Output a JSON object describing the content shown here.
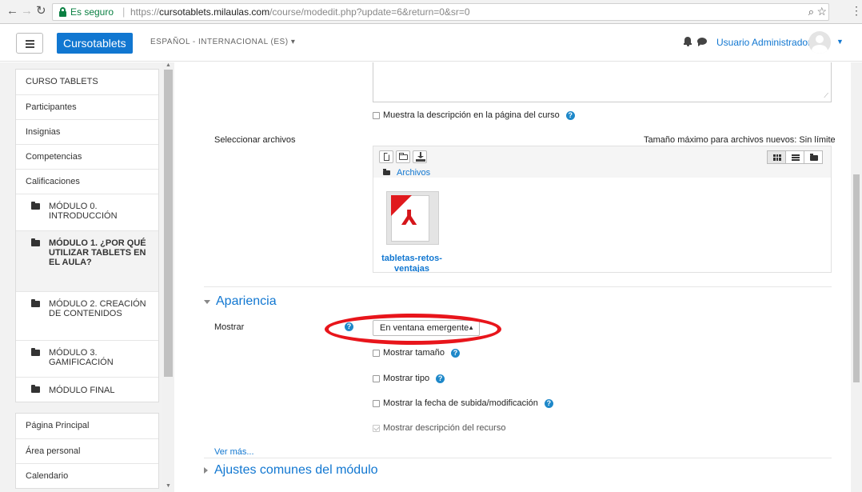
{
  "browser": {
    "secure_label": "Es seguro",
    "url_scheme": "https://",
    "url_host": "cursotablets.milaulas.com",
    "url_path": "/course/modedit.php?update=6&return=0&sr=0"
  },
  "navbar": {
    "brand": "Cursotablets",
    "language": "ESPAÑOL - INTERNACIONAL (ES) ▾",
    "user_name": "Usuario Administrador"
  },
  "sidebar": {
    "nav1": [
      {
        "label": "CURSO TABLETS"
      },
      {
        "label": "Participantes"
      },
      {
        "label": "Insignias"
      },
      {
        "label": "Competencias"
      },
      {
        "label": "Calificaciones"
      },
      {
        "label": "MÓDULO 0. INTRODUCCIÓN"
      },
      {
        "label": "MÓDULO 1. ¿POR QUÉ UTILIZAR TABLETS EN EL AULA?"
      },
      {
        "label": "MÓDULO 2. CREACIÓN DE CONTENIDOS"
      },
      {
        "label": "MÓDULO 3. GAMIFICACIÓN"
      },
      {
        "label": "MÓDULO FINAL"
      }
    ],
    "nav2": [
      {
        "label": "Página Principal"
      },
      {
        "label": "Área personal"
      },
      {
        "label": "Calendario"
      }
    ]
  },
  "form": {
    "show_description": "Muestra la descripción en la página del curso",
    "select_files_label": "Seleccionar archivos",
    "max_size": "Tamaño máximo para archivos nuevos: Sin límite",
    "breadcrumb": "Archivos",
    "file_name": "tabletas-retos-ventajas",
    "appearance_header": "Apariencia",
    "display_label": "Mostrar",
    "display_value": "En ventana emergente",
    "show_size": "Mostrar tamaño",
    "show_type": "Mostrar tipo",
    "show_date": "Mostrar la fecha de subida/modificación",
    "show_resource_desc": "Mostrar descripción del recurso",
    "see_more": "Ver más...",
    "common_settings_header": "Ajustes comunes del módulo",
    "help_glyph": "?"
  },
  "icons": [
    "back-icon",
    "forward-icon",
    "reload-icon",
    "lock-icon",
    "zoom-icon",
    "star-icon",
    "bell-icon",
    "chat-icon",
    "folder-icon",
    "file-icon",
    "download-icon",
    "grid-icon",
    "list-icon",
    "tree-icon",
    "pdf-icon",
    "help-icon"
  ],
  "colors": {
    "accent": "#1177d1",
    "secure": "#0b8043",
    "annotation_red": "#e8151b"
  }
}
